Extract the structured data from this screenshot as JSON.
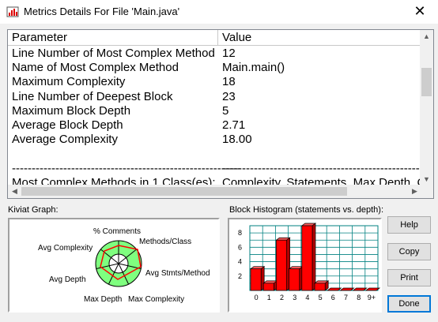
{
  "window": {
    "title": "Metrics Details For File 'Main.java'",
    "close_glyph": "✕"
  },
  "table": {
    "headers": {
      "parameter": "Parameter",
      "value": "Value"
    },
    "rows": [
      {
        "param": "Line Number of Most Complex Method",
        "value": "12"
      },
      {
        "param": "Name of Most Complex Method",
        "value": "Main.main()"
      },
      {
        "param": "Maximum Complexity",
        "value": "18"
      },
      {
        "param": "Line Number of Deepest Block",
        "value": "23"
      },
      {
        "param": "Maximum Block Depth",
        "value": "5"
      },
      {
        "param": "Average Block Depth",
        "value": "2.71"
      },
      {
        "param": "Average Complexity",
        "value": "18.00"
      },
      {
        "param": "",
        "value": ""
      },
      {
        "param": "----------------------------------------------------------",
        "value": "--------------------------------------------------------------"
      },
      {
        "param": "Most Complex Methods in 1 Class(es):",
        "value": "Complexity, Statements, Max Depth, Calls"
      }
    ]
  },
  "kiviat": {
    "label": "Kiviat Graph:",
    "axes": [
      "% Comments",
      "Methods/Class",
      "Avg Stmts/Method",
      "Max Complexity",
      "Max Depth",
      "Avg Depth",
      "Avg Complexity"
    ],
    "colors": {
      "band": "#7fff7f",
      "outline": "#000000",
      "plot": "#ff0000"
    }
  },
  "histogram": {
    "label": "Block Histogram (statements vs. depth):",
    "y_ticks": [
      "8",
      "6",
      "4",
      "2"
    ],
    "x_ticks": [
      "0",
      "1",
      "2",
      "3",
      "4",
      "5",
      "6",
      "7",
      "8",
      "9+"
    ],
    "colors": {
      "bar": "#ff0000",
      "grid": "#008080"
    }
  },
  "chart_data": {
    "type": "bar",
    "title": "Block Histogram (statements vs. depth):",
    "categories": [
      "0",
      "1",
      "2",
      "3",
      "4",
      "5",
      "6",
      "7",
      "8",
      "9+"
    ],
    "values": [
      3,
      1,
      7,
      3,
      9,
      1,
      0,
      0,
      0,
      0
    ],
    "ylim": [
      0,
      9
    ],
    "grid": true
  },
  "buttons": {
    "help": "Help",
    "copy": "Copy",
    "print": "Print",
    "done": "Done"
  }
}
